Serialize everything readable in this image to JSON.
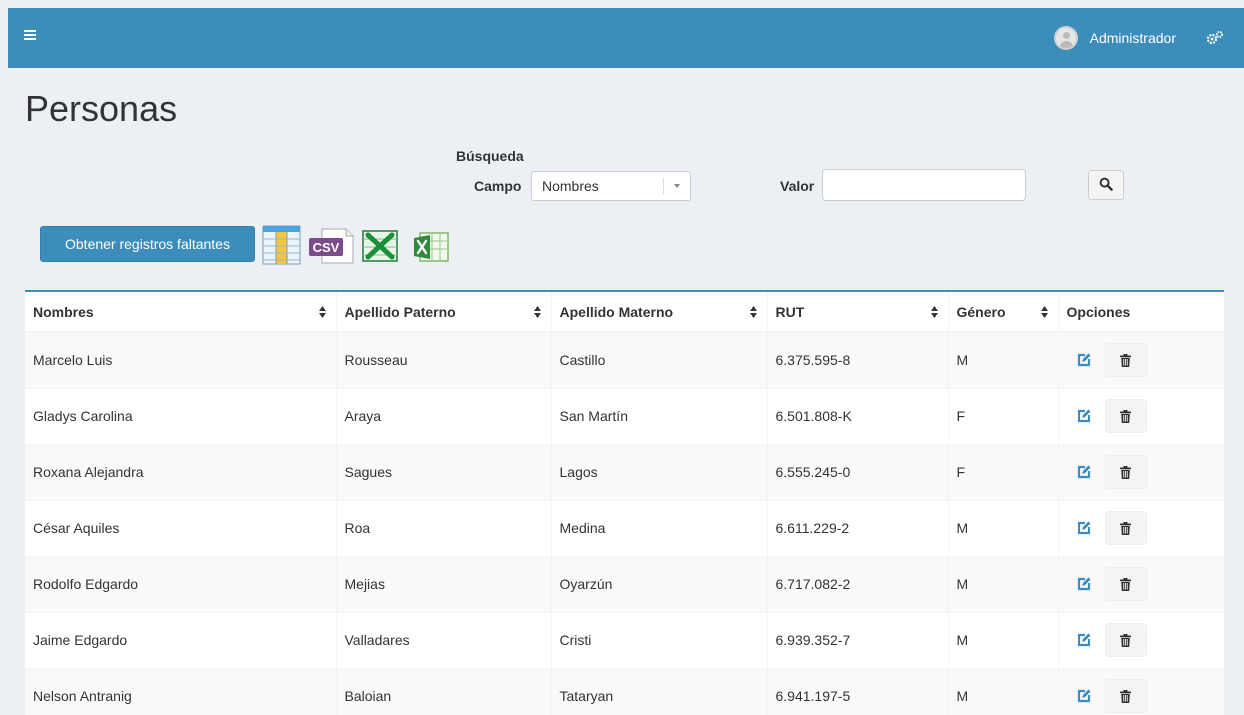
{
  "header": {
    "user_name": "Administrador"
  },
  "page": {
    "title": "Personas"
  },
  "search": {
    "heading": "Búsqueda",
    "field_label": "Campo",
    "field_value": "Nombres",
    "value_label": "Valor",
    "value_input": ""
  },
  "toolbar": {
    "fetch_label": "Obtener registros faltantes",
    "csv_label": "CSV"
  },
  "table": {
    "columns": [
      "Nombres",
      "Apellido Paterno",
      "Apellido Materno",
      "RUT",
      "Género",
      "Opciones"
    ],
    "rows": [
      [
        "Marcelo Luis",
        "Rousseau",
        "Castillo",
        "6.375.595-8",
        "M"
      ],
      [
        "Gladys Carolina",
        "Araya",
        "San Martín",
        "6.501.808-K",
        "F"
      ],
      [
        "Roxana Alejandra",
        "Sagues",
        "Lagos",
        "6.555.245-0",
        "F"
      ],
      [
        "César Aquiles",
        "Roa",
        "Medina",
        "6.611.229-2",
        "M"
      ],
      [
        "Rodolfo Edgardo",
        "Mejias",
        "Oyarzún",
        "6.717.082-2",
        "M"
      ],
      [
        "Jaime Edgardo",
        "Valladares",
        "Cristi",
        "6.939.352-7",
        "M"
      ],
      [
        "Nelson Antranig",
        "Baloian",
        "Tataryan",
        "6.941.197-5",
        "M"
      ]
    ]
  },
  "colors": {
    "header_bg": "#3c8dbc",
    "primary": "#3c8dbc",
    "edit_icon": "#3c8dbc",
    "page_bg": "#ecf0f5"
  }
}
